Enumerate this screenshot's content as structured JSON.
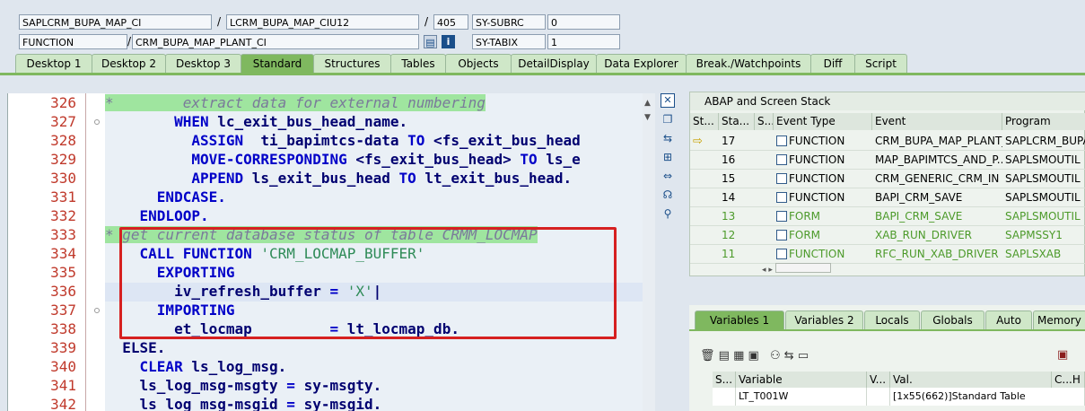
{
  "header": {
    "program": "SAPLCRM_BUPA_MAP_CI",
    "include": "LCRM_BUPA_MAP_CIU12",
    "line": "405",
    "sysvar1_name": "SY-SUBRC",
    "sysvar1_value": "0",
    "type": "FUNCTION",
    "routine": "CRM_BUPA_MAP_PLANT_CI",
    "sysvar2_name": "SY-TABIX",
    "sysvar2_value": "1",
    "slash": "/"
  },
  "tabs": [
    "Desktop 1",
    "Desktop 2",
    "Desktop 3",
    "Standard",
    "Structures",
    "Tables",
    "Objects",
    "DetailDisplay",
    "Data Explorer",
    "Break./Watchpoints",
    "Diff",
    "Script"
  ],
  "active_tab": "Standard",
  "code": {
    "line_numbers": [
      "326",
      "327",
      "328",
      "329",
      "330",
      "331",
      "332",
      "333",
      "334",
      "335",
      "336",
      "337",
      "338",
      "339",
      "340",
      "341",
      "342"
    ],
    "lines": [
      {
        "parts": [
          {
            "t": "*        extract data for external numbering",
            "c": "cmt cmtbg"
          }
        ]
      },
      {
        "parts": [
          {
            "t": "        ",
            "c": ""
          },
          {
            "t": "WHEN",
            "c": "kw"
          },
          {
            "t": " lc_exit_bus_head_name.",
            "c": "id"
          }
        ]
      },
      {
        "parts": [
          {
            "t": "          ",
            "c": ""
          },
          {
            "t": "ASSIGN",
            "c": "kw"
          },
          {
            "t": "  ti_bapimtcs-data ",
            "c": "id"
          },
          {
            "t": "TO",
            "c": "kw"
          },
          {
            "t": " <fs_exit_bus_head",
            "c": "id"
          }
        ]
      },
      {
        "parts": [
          {
            "t": "          ",
            "c": ""
          },
          {
            "t": "MOVE-CORRESPONDING",
            "c": "kw"
          },
          {
            "t": " <fs_exit_bus_head> ",
            "c": "id"
          },
          {
            "t": "TO",
            "c": "kw"
          },
          {
            "t": " ls_e",
            "c": "id"
          }
        ]
      },
      {
        "parts": [
          {
            "t": "          ",
            "c": ""
          },
          {
            "t": "APPEND",
            "c": "kw"
          },
          {
            "t": " ls_exit_bus_head ",
            "c": "id"
          },
          {
            "t": "TO",
            "c": "kw"
          },
          {
            "t": " lt_exit_bus_head.",
            "c": "id"
          }
        ]
      },
      {
        "parts": [
          {
            "t": "      ",
            "c": ""
          },
          {
            "t": "ENDCASE.",
            "c": "kw"
          }
        ]
      },
      {
        "parts": [
          {
            "t": "    ",
            "c": ""
          },
          {
            "t": "ENDLOOP.",
            "c": "kw"
          }
        ]
      },
      {
        "parts": [
          {
            "t": "* get current database status of table CRMM_LOCMAP",
            "c": "cmt cmtbg"
          }
        ]
      },
      {
        "parts": [
          {
            "t": "    ",
            "c": ""
          },
          {
            "t": "CALL FUNCTION",
            "c": "kw"
          },
          {
            "t": " ",
            "c": ""
          },
          {
            "t": "'CRM_LOCMAP_BUFFER'",
            "c": "str"
          }
        ]
      },
      {
        "parts": [
          {
            "t": "      ",
            "c": ""
          },
          {
            "t": "EXPORTING",
            "c": "kw"
          }
        ]
      },
      {
        "parts": [
          {
            "t": "        iv_refresh_buffer ",
            "c": "id"
          },
          {
            "t": "=",
            "c": "kw"
          },
          {
            "t": " ",
            "c": ""
          },
          {
            "t": "'X'",
            "c": "str"
          },
          {
            "t": "|",
            "c": "id"
          }
        ]
      },
      {
        "parts": [
          {
            "t": "      ",
            "c": ""
          },
          {
            "t": "IMPORTING",
            "c": "kw"
          }
        ]
      },
      {
        "parts": [
          {
            "t": "        et_locmap         ",
            "c": "id"
          },
          {
            "t": "=",
            "c": "kw"
          },
          {
            "t": " lt_locmap_db.",
            "c": "id"
          }
        ]
      },
      {
        "parts": [
          {
            "t": "  ",
            "c": ""
          },
          {
            "t": "ELSE.",
            "c": "id"
          }
        ]
      },
      {
        "parts": [
          {
            "t": "    ",
            "c": ""
          },
          {
            "t": "CLEAR",
            "c": "kw"
          },
          {
            "t": " ls_log_msg.",
            "c": "id"
          }
        ]
      },
      {
        "parts": [
          {
            "t": "    ls_log_msg-msgty ",
            "c": "id"
          },
          {
            "t": "=",
            "c": "kw"
          },
          {
            "t": " sy-msgty.",
            "c": "id"
          }
        ]
      },
      {
        "parts": [
          {
            "t": "    ls_log_msg-msgid ",
            "c": "id"
          },
          {
            "t": "=",
            "c": "kw"
          },
          {
            "t": " sy-msgid.",
            "c": "id"
          }
        ]
      }
    ]
  },
  "stack": {
    "title": "ABAP and Screen Stack",
    "columns": [
      "St...",
      "Sta...",
      "S...",
      "Event Type",
      "Event",
      "Program"
    ],
    "rows": [
      {
        "current": true,
        "level": "17",
        "type": "FUNCTION",
        "event": "CRM_BUPA_MAP_PLANT_...",
        "program": "SAPLCRM_BUPA_",
        "green": false
      },
      {
        "current": false,
        "level": "16",
        "type": "FUNCTION",
        "event": "MAP_BAPIMTCS_AND_P...",
        "program": "SAPLSMOUTIL",
        "green": false
      },
      {
        "current": false,
        "level": "15",
        "type": "FUNCTION",
        "event": "CRM_GENERIC_CRM_IN",
        "program": "SAPLSMOUTIL",
        "green": false
      },
      {
        "current": false,
        "level": "14",
        "type": "FUNCTION",
        "event": "BAPI_CRM_SAVE",
        "program": "SAPLSMOUTIL",
        "green": false
      },
      {
        "current": false,
        "level": "13",
        "type": "FORM",
        "event": "BAPI_CRM_SAVE",
        "program": "SAPLSMOUTIL",
        "green": true
      },
      {
        "current": false,
        "level": "12",
        "type": "FORM",
        "event": "XAB_RUN_DRIVER",
        "program": "SAPMSSY1",
        "green": true
      },
      {
        "current": false,
        "level": "11",
        "type": "FUNCTION",
        "event": "RFC_RUN_XAB_DRIVER",
        "program": "SAPLSXAB",
        "green": true
      }
    ]
  },
  "variables": {
    "tabs": [
      "Variables 1",
      "Variables 2",
      "Locals",
      "Globals",
      "Auto",
      "Memory A"
    ],
    "active_tab": "Variables 1",
    "columns": [
      "S...",
      "Variable",
      "V...",
      "Val.",
      "C...H"
    ],
    "rows": [
      {
        "variable": "LT_T001W",
        "value": "[1x55(662)]Standard Table"
      }
    ]
  }
}
